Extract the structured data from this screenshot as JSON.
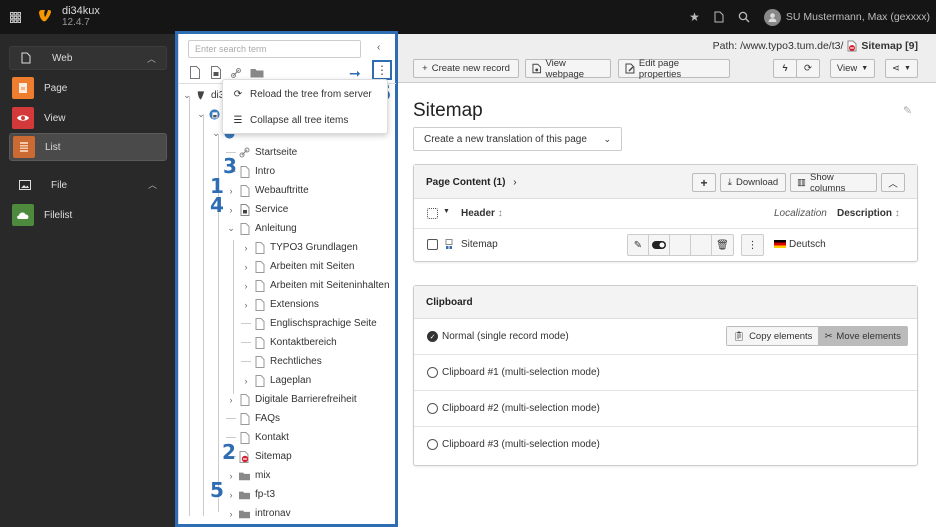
{
  "topbar": {
    "app_name": "di34kux",
    "app_version": "12.4.7",
    "user_name": "SU Mustermann, Max (gexxxx)",
    "icons": [
      "grid-menu-icon",
      "typo3-logo",
      "star-icon",
      "file-icon",
      "search-icon",
      "user-avatar-icon"
    ]
  },
  "module_menu": {
    "groups": [
      {
        "label": "Web",
        "icon": "page-icon",
        "expanded": true,
        "items": [
          {
            "label": "Page",
            "icon": "page-module-icon",
            "color": "#ee7d2f"
          },
          {
            "label": "View",
            "icon": "eye-icon",
            "color": "#d3393a"
          },
          {
            "label": "List",
            "icon": "list-icon",
            "color": "#cc6a33",
            "active": true
          }
        ]
      },
      {
        "label": "File",
        "icon": "image-icon",
        "expanded": true,
        "items": [
          {
            "label": "Filelist",
            "icon": "cloud-icon",
            "color": "#4e8a3d"
          }
        ]
      }
    ]
  },
  "page_tree": {
    "search_placeholder": "Enter search term",
    "root_label": "di34",
    "context_menu": [
      {
        "label": "Reload the tree from server",
        "icon": "refresh-icon"
      },
      {
        "label": "Collapse all tree items",
        "icon": "collapse-list-icon"
      }
    ],
    "nodes": [
      {
        "label": "Startseite",
        "icon": "link-icon",
        "level": 3,
        "expander": ""
      },
      {
        "label": "Intro",
        "icon": "page-icon",
        "level": 3,
        "expander": ""
      },
      {
        "label": "Webauftritte",
        "icon": "page-icon",
        "level": 3,
        "expander": ">"
      },
      {
        "label": "Service",
        "icon": "shortcut-page-icon",
        "level": 3,
        "expander": ">"
      },
      {
        "label": "Anleitung",
        "icon": "page-icon",
        "level": 3,
        "expander": "v"
      },
      {
        "label": "TYPO3 Grundlagen",
        "icon": "page-icon",
        "level": 4,
        "expander": ">"
      },
      {
        "label": "Arbeiten mit Seiten",
        "icon": "page-icon",
        "level": 4,
        "expander": ">"
      },
      {
        "label": "Arbeiten mit Seiteninhalten",
        "icon": "page-icon",
        "level": 4,
        "expander": ">"
      },
      {
        "label": "Extensions",
        "icon": "page-icon",
        "level": 4,
        "expander": ">"
      },
      {
        "label": "Englischsprachige Seite",
        "icon": "page-icon",
        "level": 4,
        "expander": ""
      },
      {
        "label": "Kontaktbereich",
        "icon": "page-icon",
        "level": 4,
        "expander": ""
      },
      {
        "label": "Rechtliches",
        "icon": "page-icon",
        "level": 4,
        "expander": ""
      },
      {
        "label": "Lageplan",
        "icon": "page-icon",
        "level": 4,
        "expander": ">"
      },
      {
        "label": "Digitale Barrierefreiheit",
        "icon": "page-icon",
        "level": 3,
        "expander": ">"
      },
      {
        "label": "FAQs",
        "icon": "page-icon",
        "level": 3,
        "expander": ""
      },
      {
        "label": "Kontakt",
        "icon": "page-icon",
        "level": 3,
        "expander": ""
      },
      {
        "label": "Sitemap",
        "icon": "page-hidden-icon",
        "level": 3,
        "expander": ""
      },
      {
        "label": "mix",
        "icon": "folder-icon",
        "level": 3,
        "expander": ">"
      },
      {
        "label": "fp-t3",
        "icon": "folder-icon",
        "level": 3,
        "expander": ">"
      },
      {
        "label": "intronav",
        "icon": "folder-icon",
        "level": 3,
        "expander": ">"
      }
    ],
    "annotations": {
      "n1": "1",
      "n2": "2",
      "n3": "3",
      "n4": "4",
      "n5": "5",
      "n6": "6"
    }
  },
  "docheader": {
    "path_label": "Path: /www.typo3.tum.de/t3/",
    "path_page": "Sitemap [9]",
    "buttons": {
      "create_new_record": "Create new record",
      "view_webpage": "View webpage",
      "edit_page_properties": "Edit page properties",
      "view": "View"
    }
  },
  "main": {
    "title": "Sitemap",
    "translation_select": "Create a new translation of this page",
    "page_content": {
      "title": "Page Content (1)",
      "download": "Download",
      "show_columns": "Show columns",
      "columns": {
        "header": "Header",
        "localization": "Localization",
        "description": "Description"
      },
      "rows": [
        {
          "header": "Sitemap",
          "language": "Deutsch"
        }
      ]
    },
    "clipboard": {
      "title": "Clipboard",
      "modes": [
        {
          "label": "Normal (single record mode)",
          "selected": true
        },
        {
          "label": "Clipboard #1 (multi-selection mode)",
          "selected": false
        },
        {
          "label": "Clipboard #2 (multi-selection mode)",
          "selected": false
        },
        {
          "label": "Clipboard #3 (multi-selection mode)",
          "selected": false
        }
      ],
      "copy_label": "Copy elements",
      "move_label": "Move elements"
    }
  },
  "colors": {
    "annotation_blue": "#2f6db3",
    "topbar": "#151515",
    "module_menu": "#292929",
    "typo3_orange": "#f49700"
  }
}
